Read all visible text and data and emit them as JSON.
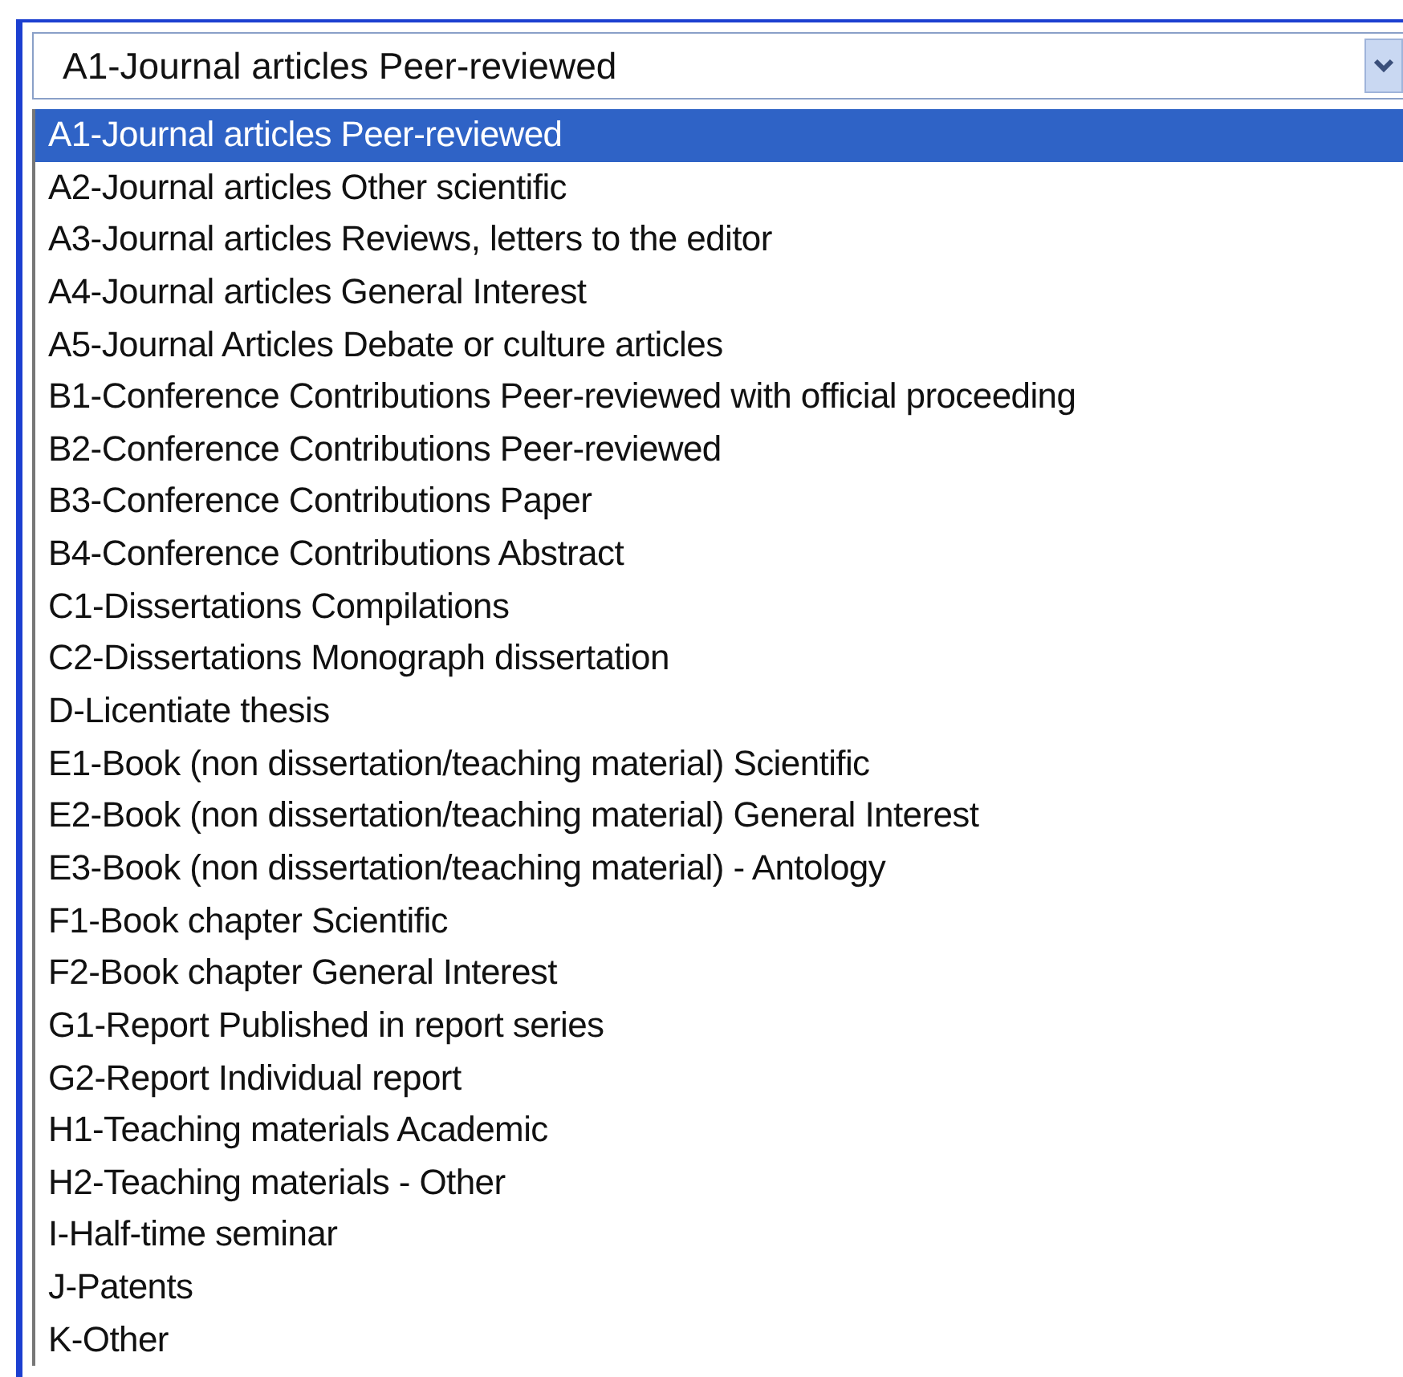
{
  "combo": {
    "value": "A1-Journal articles Peer-reviewed",
    "expanded": true
  },
  "options": [
    {
      "label": "A1-Journal articles Peer-reviewed",
      "selected": true
    },
    {
      "label": "A2-Journal articles Other scientific",
      "selected": false
    },
    {
      "label": "A3-Journal articles Reviews, letters to the editor",
      "selected": false
    },
    {
      "label": "A4-Journal articles General Interest",
      "selected": false
    },
    {
      "label": "A5-Journal Articles Debate or culture articles",
      "selected": false
    },
    {
      "label": "B1-Conference Contributions Peer-reviewed with official proceeding",
      "selected": false
    },
    {
      "label": "B2-Conference Contributions Peer-reviewed",
      "selected": false
    },
    {
      "label": "B3-Conference Contributions Paper",
      "selected": false
    },
    {
      "label": "B4-Conference Contributions Abstract",
      "selected": false
    },
    {
      "label": "C1-Dissertations Compilations",
      "selected": false
    },
    {
      "label": "C2-Dissertations Monograph dissertation",
      "selected": false
    },
    {
      "label": "D-Licentiate thesis",
      "selected": false
    },
    {
      "label": "E1-Book (non dissertation/teaching material) Scientific",
      "selected": false
    },
    {
      "label": "E2-Book (non dissertation/teaching material) General Interest",
      "selected": false
    },
    {
      "label": "E3-Book (non dissertation/teaching material) - Antology",
      "selected": false
    },
    {
      "label": "F1-Book chapter Scientific",
      "selected": false
    },
    {
      "label": "F2-Book chapter General Interest",
      "selected": false
    },
    {
      "label": "G1-Report Published in report series",
      "selected": false
    },
    {
      "label": "G2-Report Individual report",
      "selected": false
    },
    {
      "label": "H1-Teaching materials Academic",
      "selected": false
    },
    {
      "label": "H2-Teaching materials - Other",
      "selected": false
    },
    {
      "label": "I-Half-time seminar",
      "selected": false
    },
    {
      "label": "J-Patents",
      "selected": false
    },
    {
      "label": "K-Other",
      "selected": false
    }
  ]
}
